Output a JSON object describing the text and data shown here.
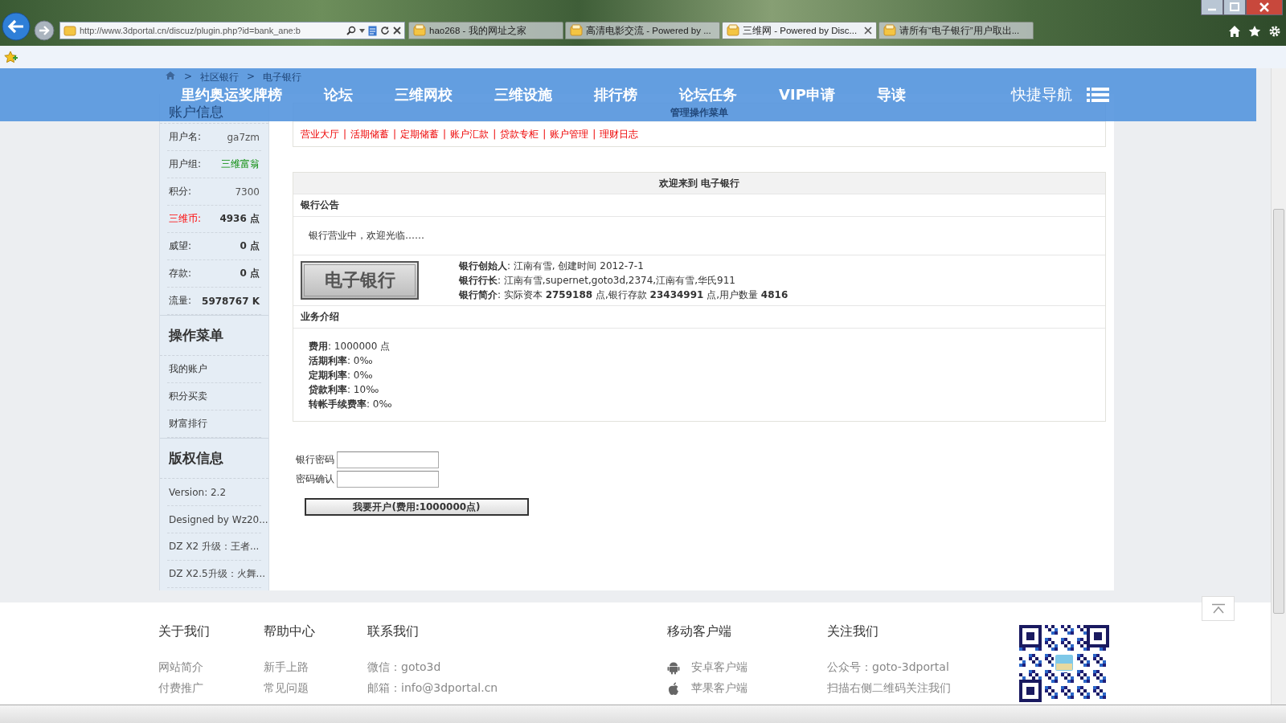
{
  "browser": {
    "address": "http://www.3dportal.cn/discuz/plugin.php?id=bank_ane:b",
    "tabs": [
      {
        "title": "hao268 - 我的网址之家",
        "selected": false
      },
      {
        "title": "高清电影交流 - Powered by ...",
        "selected": false
      },
      {
        "title": "三维网 - Powered by Disc...",
        "selected": true
      },
      {
        "title": "请所有“电子银行”用户取出...",
        "selected": false
      }
    ]
  },
  "breadcrumb": {
    "separator": ">",
    "items": [
      "社区银行",
      "电子银行"
    ]
  },
  "nav": {
    "items": [
      "里约奥运奖牌榜",
      "论坛",
      "三维网校",
      "三维设施",
      "排行榜",
      "论坛任务",
      "VIP申请",
      "导读"
    ],
    "quick_nav": "快捷导航"
  },
  "sidebar": {
    "sections": [
      {
        "title": "账户信息",
        "kind": "info",
        "rows": [
          {
            "label": "用户名:",
            "value": "ga7zm",
            "kind": "plain"
          },
          {
            "label": "用户组:",
            "value": "三维富翁",
            "kind": "group"
          },
          {
            "label": "积分:",
            "value": "7300",
            "kind": "plain"
          },
          {
            "label": "三维币:",
            "value": "4936 点",
            "kind": "currency"
          },
          {
            "label": "威望:",
            "value": "0 点",
            "kind": "bold"
          },
          {
            "label": "存款:",
            "value": "0 点",
            "kind": "bold"
          },
          {
            "label": "流量:",
            "value": "5978767 K",
            "kind": "bold"
          }
        ]
      },
      {
        "title": "操作菜单",
        "kind": "menu",
        "items": [
          "我的账户",
          "积分买卖",
          "财富排行"
        ]
      },
      {
        "title": "版权信息",
        "kind": "list",
        "items": [
          "Version: 2.2",
          "Designed by Wz20...",
          "DZ X2 升级：王者...",
          "DZ X2.5升级：火舞..."
        ]
      }
    ]
  },
  "admin_menu": {
    "title": "管理操作菜单",
    "separator": "|",
    "items": [
      "营业大厅",
      "活期储蓄",
      "定期储蓄",
      "账户汇款",
      "贷款专柜",
      "账户管理",
      "理财日志"
    ]
  },
  "welcome": {
    "title": "欢迎来到 电子银行",
    "notice_title": "银行公告",
    "notice": "银行营业中，欢迎光临……",
    "logo_text": "电子银行",
    "details": [
      "**银行创始人**: 江南有雪, 创建时间  2012-7-1",
      "**银行行长**: 江南有雪,supernet,goto3d,2374,江南有雪,华氏911",
      "**银行简介**: 实际资本  **2759188** 点,银行存款  **23434991** 点,用户数量  **4816**"
    ],
    "services_title": "业务介绍",
    "services": [
      "**费用**: 1000000 点",
      "**活期利率**: 0‰",
      "**定期利率**: 0‰",
      "**贷款利率**: 10‰",
      "**转帐手续费率**: 0‰"
    ]
  },
  "form": {
    "fields": [
      {
        "label": "银行密码"
      },
      {
        "label": "密码确认"
      }
    ],
    "submit": "我要开户(费用:1000000点)"
  },
  "footer": {
    "columns": [
      {
        "title": "关于我们",
        "links": [
          {
            "text": "网站简介",
            "kind": "text"
          },
          {
            "text": "付费推广",
            "kind": "text"
          }
        ]
      },
      {
        "title": "帮助中心",
        "links": [
          {
            "text": "新手上路",
            "kind": "text"
          },
          {
            "text": "常见问题",
            "kind": "text"
          }
        ]
      },
      {
        "title": "联系我们",
        "links": [
          {
            "text": "微信：goto3d",
            "kind": "text"
          },
          {
            "text": "邮箱：info@3dportal.cn",
            "kind": "text"
          }
        ]
      },
      {
        "title": "移动客户端",
        "links": [
          {
            "text": "安卓客户端",
            "kind": "android"
          },
          {
            "text": "苹果客户端",
            "kind": "apple"
          }
        ]
      },
      {
        "title": "关注我们",
        "links": [
          {
            "text": "公众号：goto-3dportal",
            "kind": "text"
          },
          {
            "text": "扫描右侧二维码关注我们",
            "kind": "text"
          }
        ]
      }
    ]
  }
}
